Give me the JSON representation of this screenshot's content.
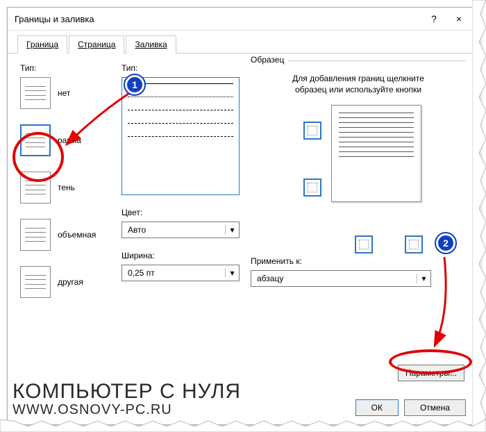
{
  "title": "Границы и заливка",
  "help": "?",
  "close": "×",
  "tabs": {
    "border": "Граница",
    "page": "Страница",
    "fill": "Заливка"
  },
  "left": {
    "label": "Тип:",
    "none": "нет",
    "box": "рамка",
    "shadow": "тень",
    "threeD": "объемная",
    "custom": "другая"
  },
  "mid": {
    "type_label": "Тип:",
    "color_label": "Цвет:",
    "color_value": "Авто",
    "width_label": "Ширина:",
    "width_value": "0,25 пт"
  },
  "right": {
    "legend": "Образец",
    "hint": "Для добавления границ щелкните образец или используйте кнопки",
    "apply_label": "Применить к:",
    "apply_value": "абзацу",
    "options": "Параметры..."
  },
  "buttons": {
    "ok": "ОК",
    "cancel": "Отмена"
  },
  "callouts": {
    "one": "1",
    "two": "2"
  },
  "watermark": {
    "line1": "КОМПЬЮТЕР С НУЛЯ",
    "line2": "WWW.OSNOVY-PC.RU"
  }
}
